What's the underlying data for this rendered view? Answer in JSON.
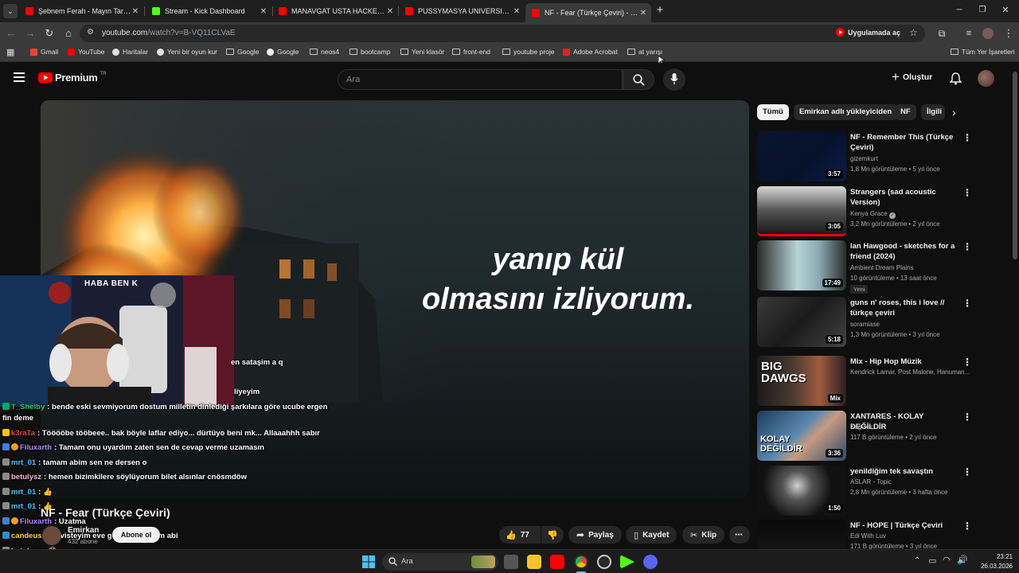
{
  "browser": {
    "tabs": [
      {
        "title": "Şebnem Ferah - Mayın Tarlası (Lyric Video)",
        "favicon_color": "#ff0000"
      },
      {
        "title": "Stream - Kick Dashboard",
        "favicon_color": "#53fc18"
      },
      {
        "title": "MANAVGAT USTA HACKERLAR",
        "favicon_color": "#ff0000"
      },
      {
        "title": "PUSSYMASYA UNIVERSITY | Ma...",
        "favicon_color": "#ff0000"
      },
      {
        "title": "NF - Fear (Türkçe Çeviri) - YouTube",
        "favicon_color": "#ff0000"
      }
    ],
    "new_tab": "+",
    "url_host": "youtube.com",
    "url_path": "/watch?v=B-VQ11CLVaE",
    "open_in_app": "Uygulamada aç",
    "bookmarks": [
      "Gmail",
      "YouTube",
      "Haritalar",
      "Yeni bir oyun kur",
      "Google",
      "Google",
      "neos4",
      "bootcamp",
      "Yeni klasör",
      "front-end",
      "youtube proje",
      "Adobe Acrobat",
      "at yarışı"
    ],
    "all_bookmarks": "Tüm Yer İşaretleri"
  },
  "youtube": {
    "logo_text": "Premium",
    "logo_badge": "TR",
    "search_placeholder": "Ara",
    "create_label": "Oluştur",
    "lyrics_line1": "yanıp kül",
    "lyrics_line2": "olmasını izliyorum.",
    "video_title": "NF - Fear (Türkçe Çeviri)",
    "channel_name": "Emirkan",
    "subscribers": "432 abone",
    "subscribe_label": "Abone ol",
    "like_count": "77",
    "share_label": "Paylaş",
    "save_label": "Kaydet",
    "clip_label": "Klip",
    "chips": [
      "Tümü",
      "Emirkan adlı yükleyiciden",
      "NF",
      "İlgili"
    ],
    "recommendations": [
      {
        "title": "NF - Remember This (Türkçe Çeviri)",
        "channel": "gizemkurt",
        "meta": "1,8 Mn görüntüleme • 5 yıl önce",
        "duration": "3:57"
      },
      {
        "title": "Strangers (sad acoustic Version)",
        "channel": "Kenya Grace",
        "meta": "3,2 Mn görüntüleme • 2 yıl önce",
        "duration": "3:05"
      },
      {
        "title": "Ian Hawgood - sketches for a friend (2024)",
        "channel": "Ambient Dream Plains",
        "meta": "10 görüntüleme • 13 saat önce",
        "badge": "Yeni",
        "duration": "17:49"
      },
      {
        "title": "guns n' roses, this i love // türkçe çeviri",
        "channel": "soramiase",
        "meta": "1,3 Mn görüntüleme • 3 yıl önce",
        "duration": "5:18"
      },
      {
        "title": "Mix - Hip Hop Müzik",
        "channel": "Kendrick Lamar, Post Malone, Hanuman...",
        "meta": "",
        "duration": "Mix"
      },
      {
        "title": "XANTARES - KOLAY DEĞİLDİR",
        "channel": "Xagvick",
        "meta": "117 B görüntüleme • 2 yıl önce",
        "duration": "3:36"
      },
      {
        "title": "yenildiğim tek savaştın",
        "channel": "ASLAR - Topic",
        "meta": "2,8 Mn görüntüleme • 3 hafta önce",
        "duration": "1:50"
      },
      {
        "title": "NF - HOPE | Türkçe Çeviri",
        "channel": "Edi With Luv",
        "meta": "171 B görüntüleme • 3 yıl önce",
        "duration": ""
      }
    ]
  },
  "stream_overlay": {
    "webcam_banner": "HABA BEN K",
    "chat": [
      {
        "user": "",
        "text": "en sataşim a q",
        "color": "#ffffff"
      },
      {
        "user": "",
        "text": "liyeyim",
        "color": "#ffffff"
      },
      {
        "user": "T_Shelby",
        "text": ": bende eski sevmiyorum dostum milletin dinlediği şarkılara göre ucube ergen",
        "color": "#2ecc71"
      },
      {
        "user": "",
        "text": "fin deme",
        "color": "#ffffff"
      },
      {
        "user": "k3raTa",
        "text": ": Tööööbe tööbeee.. bak böyle laflar ediyo... dürtüyo beni mk... Allaaahhh sabır",
        "color": "#e74c3c"
      },
      {
        "user": "Filuxarth",
        "text": ": Tamam onu uyardım zaten sen de cevap verme uzamasın",
        "color": "#b388ff"
      },
      {
        "user": "mrt_01",
        "text": ": tamam abim sen ne dersen o",
        "color": "#4fc3f7"
      },
      {
        "user": "betulysz",
        "text": ": hemen bizimkilere söylüyorum bilet alsınlar cnösmdöw",
        "color": "#f8bbd0"
      },
      {
        "user": "mrt_01",
        "text": ": 👍",
        "color": "#4fc3f7"
      },
      {
        "user": "mrt_01",
        "text": ": 👍",
        "color": "#4fc3f7"
      },
      {
        "user": "Filuxarth",
        "text": ": Uzatma",
        "color": "#b388ff"
      },
      {
        "user": "candeus",
        "text": ": servisteyim eve gelince dinlerim abi",
        "color": "#ffd54f"
      },
      {
        "user": "betulysz",
        "text": ": 😊",
        "color": "#f8bbd0"
      }
    ]
  },
  "taskbar": {
    "search_placeholder": "Ara",
    "time": "23:21",
    "date": "26.03.2026"
  }
}
